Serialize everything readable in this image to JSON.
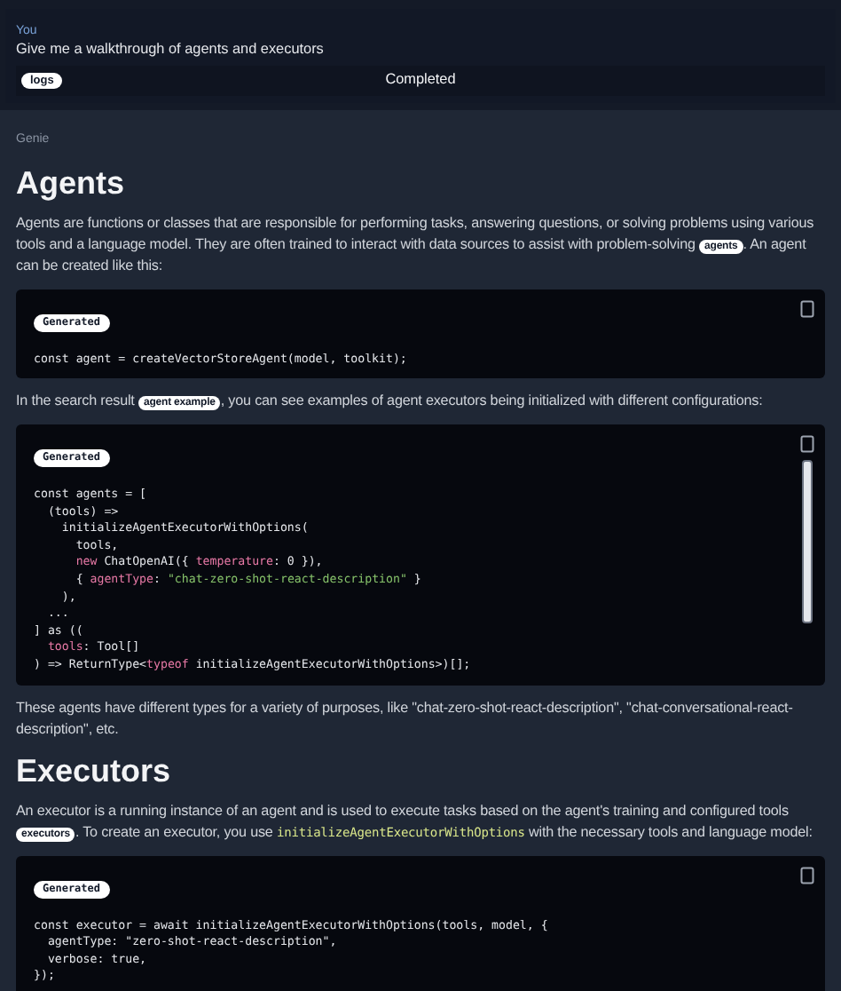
{
  "user_message": {
    "author": "You",
    "text": "Give me a walkthrough of agents and executors",
    "logs_label": "logs",
    "status": "Completed"
  },
  "reply": {
    "author": "Genie",
    "blocks": [
      {
        "kind": "heading",
        "text": "Agents"
      },
      {
        "kind": "paragraph",
        "parts": [
          {
            "kind": "text",
            "text": "Agents are functions or classes that are responsible for performing tasks, answering questions, or solving problems using various tools and a language model. They are often trained to interact with data sources to assist with problem-solving "
          },
          {
            "kind": "chip",
            "text": "agents"
          },
          {
            "kind": "text",
            "text": ". An agent can be created like this:"
          }
        ]
      },
      {
        "kind": "code",
        "badge": "Generated",
        "scroll": false,
        "lines": [
          [
            {
              "kind": "plain",
              "text": "const agent = createVectorStoreAgent(model, toolkit);"
            }
          ]
        ]
      },
      {
        "kind": "paragraph",
        "parts": [
          {
            "kind": "text",
            "text": "In the search result "
          },
          {
            "kind": "chip",
            "text": "agent example"
          },
          {
            "kind": "text",
            "text": ", you can see examples of agent executors being initialized with different configurations:"
          }
        ]
      },
      {
        "kind": "code",
        "badge": "Generated",
        "scroll": true,
        "lines": [
          [
            {
              "kind": "plain",
              "text": "const agents = ["
            }
          ],
          [
            {
              "kind": "plain",
              "text": "  (tools) =>"
            }
          ],
          [
            {
              "kind": "plain",
              "text": "    initializeAgentExecutorWithOptions("
            }
          ],
          [
            {
              "kind": "plain",
              "text": "      tools,"
            }
          ],
          [
            {
              "kind": "keyword",
              "text": "      new "
            },
            {
              "kind": "plain",
              "text": "ChatOpenAI({ "
            },
            {
              "kind": "key",
              "text": "temperature"
            },
            {
              "kind": "plain",
              "text": ": 0 }),"
            }
          ],
          [
            {
              "kind": "plain",
              "text": "      { "
            },
            {
              "kind": "key",
              "text": "agentType"
            },
            {
              "kind": "plain",
              "text": ": "
            },
            {
              "kind": "string",
              "text": "\"chat-zero-shot-react-description\""
            },
            {
              "kind": "plain",
              "text": " }"
            }
          ],
          [
            {
              "kind": "plain",
              "text": "    ),"
            }
          ],
          [
            {
              "kind": "plain",
              "text": "  ..."
            }
          ],
          [
            {
              "kind": "plain",
              "text": "] as (("
            }
          ],
          [
            {
              "kind": "key",
              "text": "  tools"
            },
            {
              "kind": "plain",
              "text": ": Tool[]"
            }
          ],
          [
            {
              "kind": "plain",
              "text": ") => ReturnType<"
            },
            {
              "kind": "keyword",
              "text": "typeof"
            },
            {
              "kind": "plain",
              "text": " initializeAgentExecutorWithOptions>)[];"
            }
          ]
        ]
      },
      {
        "kind": "paragraph",
        "parts": [
          {
            "kind": "text",
            "text": "These agents have different types for a variety of purposes, like \"chat-zero-shot-react-description\", \"chat-conversational-react-description\", etc."
          }
        ]
      },
      {
        "kind": "heading",
        "text": "Executors"
      },
      {
        "kind": "paragraph",
        "parts": [
          {
            "kind": "text",
            "text": "An executor is a running instance of an agent and is used to execute tasks based on the agent's training and configured tools "
          },
          {
            "kind": "chip",
            "text": "executors"
          },
          {
            "kind": "text",
            "text": ". To create an executor, you use "
          },
          {
            "kind": "code",
            "text": "initializeAgentExecutorWithOptions"
          },
          {
            "kind": "text",
            "text": " with the necessary tools and language model:"
          }
        ]
      },
      {
        "kind": "code",
        "badge": "Generated",
        "scroll": false,
        "lines": [
          [
            {
              "kind": "plain",
              "text": "const executor = await initializeAgentExecutorWithOptions(tools, model, {"
            }
          ],
          [
            {
              "kind": "plain",
              "text": "  agentType: \"zero-shot-react-description\","
            }
          ],
          [
            {
              "kind": "plain",
              "text": "  verbose: true,"
            }
          ],
          [
            {
              "kind": "plain",
              "text": "});"
            }
          ]
        ]
      }
    ]
  }
}
